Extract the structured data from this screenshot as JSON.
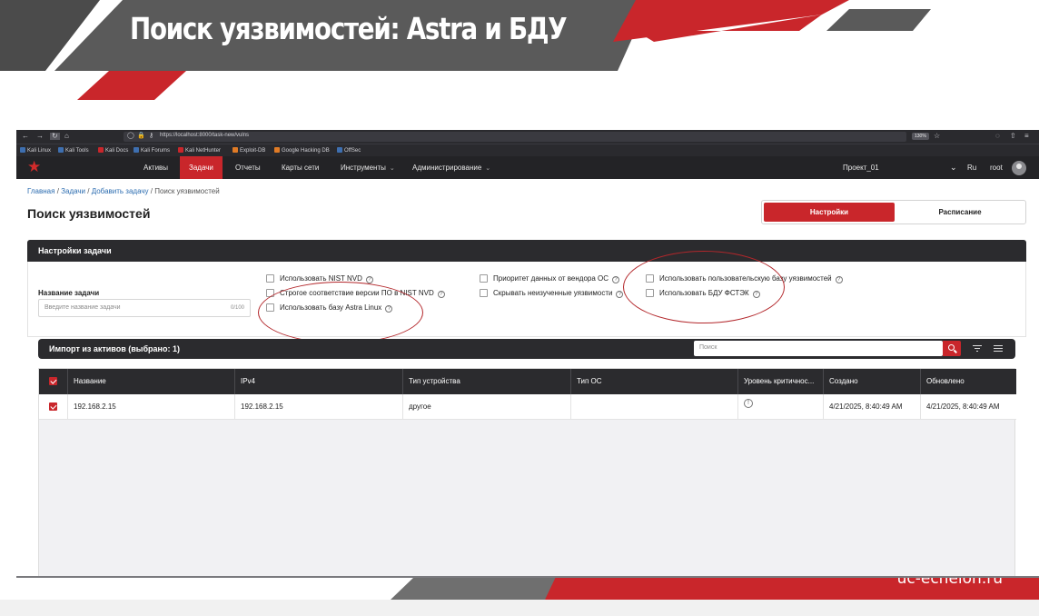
{
  "slide": {
    "title": "Поиск уязвимостей: Astra и БДУ",
    "footer_brand": "uc-echelon.ru",
    "colors": {
      "red": "#c9262b",
      "dark_gray": "#4a4a4a",
      "light_gray": "#6f6f6f"
    }
  },
  "browser": {
    "url": "https://localhost:8000/task-new/vulns",
    "zoom": "130%",
    "bookmarks": [
      "Kali Linux",
      "Kali Tools",
      "Kali Docs",
      "Kali Forums",
      "Kali NetHunter",
      "Exploit-DB",
      "Google Hacking DB",
      "OffSec"
    ]
  },
  "app": {
    "logo_icon": "red-star-icon",
    "nav": {
      "items": [
        "Активы",
        "Задачи",
        "Отчеты",
        "Карты сети",
        "Инструменты",
        "Администрирование"
      ],
      "active": "Задачи",
      "project": "Проект_01",
      "language": "Ru",
      "user": "root"
    },
    "breadcrumb": {
      "home": "Главная",
      "sep": "/",
      "tasks": "Задачи",
      "add_task": "Добавить задачу",
      "current": "Поиск уязвимостей"
    },
    "page_title": "Поиск уязвимостей",
    "tabs": {
      "settings": "Настройки",
      "schedule": "Расписание"
    },
    "task_settings": {
      "section_title": "Настройки задачи",
      "name_label": "Название задачи",
      "name_placeholder": "Введите название задачи",
      "name_counter": "0/100",
      "options": {
        "nist_nvd": "Использовать NIST NVD",
        "strict_version": "Строгое соответствие версии ПО в NIST NVD",
        "astra_db": "Использовать базу Astra Linux",
        "vendor_priority": "Приоритет данных от вендора ОС",
        "hide_unstudied": "Скрывать неизученные уязвимости",
        "custom_db": "Использовать пользовательскую базу уязвимостей",
        "bdu_fstec": "Использовать БДУ ФСТЭК"
      },
      "help_glyph": "?"
    },
    "import": {
      "title": "Импорт из активов (выбрано: 1)",
      "search_placeholder": "Поиск"
    },
    "table": {
      "columns": [
        "Название",
        "IPv4",
        "Тип устройства",
        "Тип ОС",
        "Уровень критичнос...",
        "Создано",
        "Обновлено"
      ],
      "rows": [
        {
          "name": "192.168.2.15",
          "ipv4": "192.168.2.15",
          "device_type": "другое",
          "os_type": "",
          "criticality_icon": "!",
          "created": "4/21/2025, 8:40:49 AM",
          "updated": "4/21/2025, 8:40:49 AM",
          "selected": true
        }
      ]
    }
  }
}
